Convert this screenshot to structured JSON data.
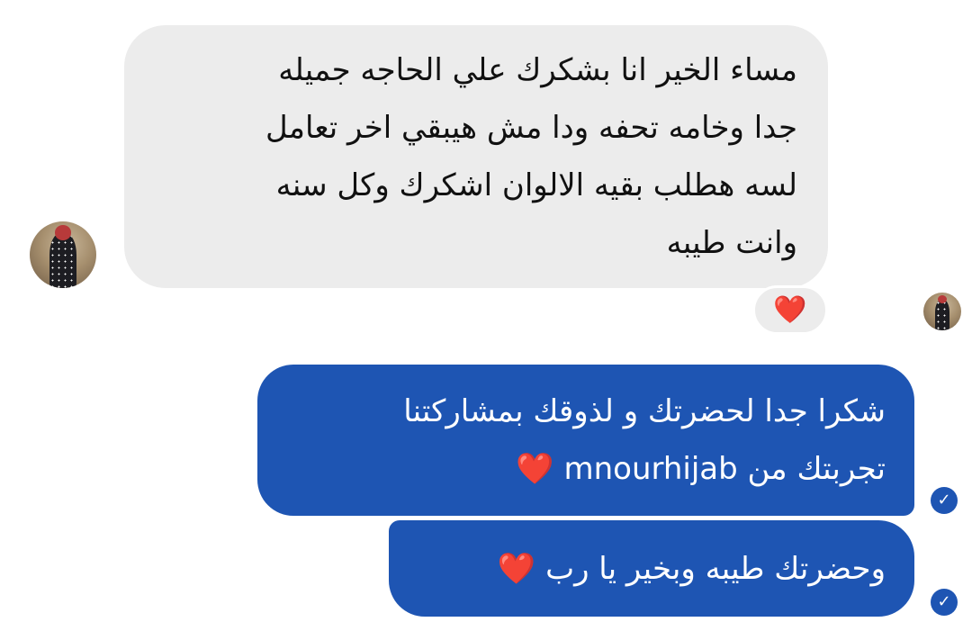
{
  "conversation": {
    "incoming": {
      "lines": [
        "مساء الخير انا بشكرك علي الحاجه جميله",
        "جدا وخامه تحفه ودا مش هيبقي اخر تعامل",
        "لسه هطلب بقيه الالوان اشكرك وكل سنه",
        "وانت طيبه"
      ],
      "reaction": "❤️"
    },
    "outgoing": [
      {
        "lines": [
          "شكرا جدا لحضرتك و لذوقك بمشاركتنا",
          "تجربتك من mnourhijab"
        ],
        "emoji": "❤️",
        "status_icon": "read-check-icon"
      },
      {
        "lines": [
          "وحضرتك طيبه وبخير يا رب"
        ],
        "emoji": "❤️",
        "status_icon": "read-check-icon"
      }
    ]
  },
  "colors": {
    "incoming_bubble": "#ececec",
    "outgoing_bubble": "#1e55b3",
    "heart": "#e0191f"
  }
}
